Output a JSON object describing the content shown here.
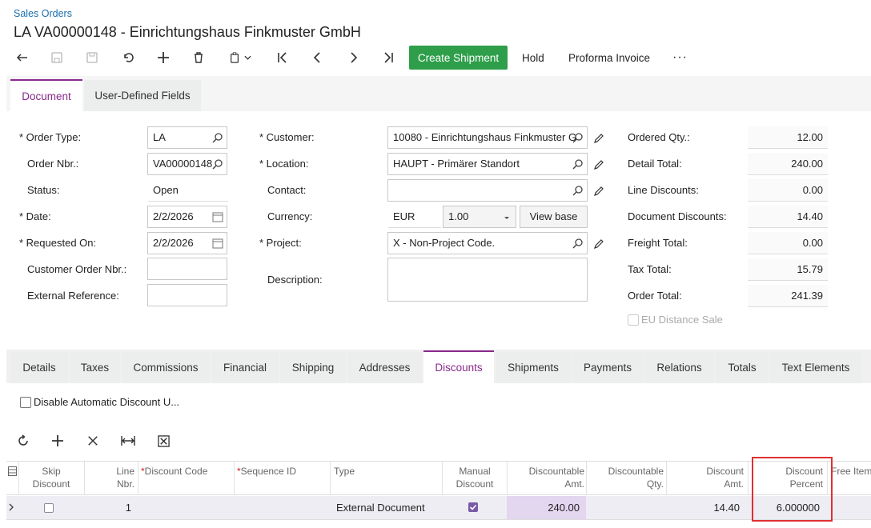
{
  "header": {
    "breadcrumb": "Sales Orders",
    "title": "LA VA00000148 - Einrichtungshaus Finkmuster GmbH"
  },
  "toolbar": {
    "create_shipment": "Create Shipment",
    "hold": "Hold",
    "proforma": "Proforma Invoice",
    "more": "···"
  },
  "form_tabs": {
    "document": "Document",
    "user_defined": "User-Defined Fields"
  },
  "fields": {
    "order_type": {
      "label": "* Order Type:",
      "value": "LA"
    },
    "order_nbr": {
      "label": "Order Nbr.:",
      "value": "VA00000148"
    },
    "status": {
      "label": "Status:",
      "value": "Open"
    },
    "date": {
      "label": "* Date:",
      "value": "2/2/2026"
    },
    "requested_on": {
      "label": "* Requested On:",
      "value": "2/2/2026"
    },
    "customer_order_nbr": {
      "label": "Customer Order Nbr.:",
      "value": ""
    },
    "external_reference": {
      "label": "External Reference:",
      "value": ""
    },
    "customer": {
      "label": "* Customer:",
      "value": "10080 - Einrichtungshaus Finkmuster G"
    },
    "location": {
      "label": "* Location:",
      "value": "HAUPT - Primärer Standort"
    },
    "contact": {
      "label": "Contact:",
      "value": ""
    },
    "currency": {
      "label": "Currency:",
      "value": "EUR",
      "rate": "1.00",
      "view_base": "View base"
    },
    "project": {
      "label": "* Project:",
      "value": "X - Non-Project Code."
    },
    "description": {
      "label": "Description:",
      "value": ""
    }
  },
  "totals": {
    "ordered_qty": {
      "label": "Ordered Qty.:",
      "value": "12.00"
    },
    "detail_total": {
      "label": "Detail Total:",
      "value": "240.00"
    },
    "line_discounts": {
      "label": "Line Discounts:",
      "value": "0.00"
    },
    "document_discounts": {
      "label": "Document Discounts:",
      "value": "14.40"
    },
    "freight_total": {
      "label": "Freight Total:",
      "value": "0.00"
    },
    "tax_total": {
      "label": "Tax Total:",
      "value": "15.79"
    },
    "order_total": {
      "label": "Order Total:",
      "value": "241.39"
    },
    "eu_distance_sale": "EU Distance Sale"
  },
  "lower_tabs": [
    "Details",
    "Taxes",
    "Commissions",
    "Financial",
    "Shipping",
    "Addresses",
    "Discounts",
    "Shipments",
    "Payments",
    "Relations",
    "Totals",
    "Text Elements"
  ],
  "active_lower_tab": "Discounts",
  "disable_auto_discount": "Disable Automatic Discount U...",
  "grid": {
    "headers": {
      "skip_discount": [
        "Skip",
        "Discount"
      ],
      "line_nbr": [
        "Line",
        "Nbr."
      ],
      "discount_code": "Discount Code",
      "sequence_id": "Sequence ID",
      "type": "Type",
      "manual_discount": [
        "Manual",
        "Discount"
      ],
      "discountable_amt": [
        "Discountable",
        "Amt."
      ],
      "discountable_qty": [
        "Discountable",
        "Qty."
      ],
      "discount_amt": [
        "Discount",
        "Amt."
      ],
      "discount_percent": [
        "Discount",
        "Percent"
      ],
      "free_item": "Free Item"
    },
    "rows": [
      {
        "line_nbr": "1",
        "discount_code": "",
        "sequence_id": "",
        "type": "External Document",
        "manual_discount": true,
        "discountable_amt": "240.00",
        "discountable_qty": "",
        "discount_amt": "14.40",
        "discount_percent": "6.000000"
      }
    ]
  },
  "colors": {
    "accent": "#8a2a8c",
    "primary_button": "#2e9e4a",
    "link": "#1a6fb0",
    "highlight": "#e03030"
  }
}
